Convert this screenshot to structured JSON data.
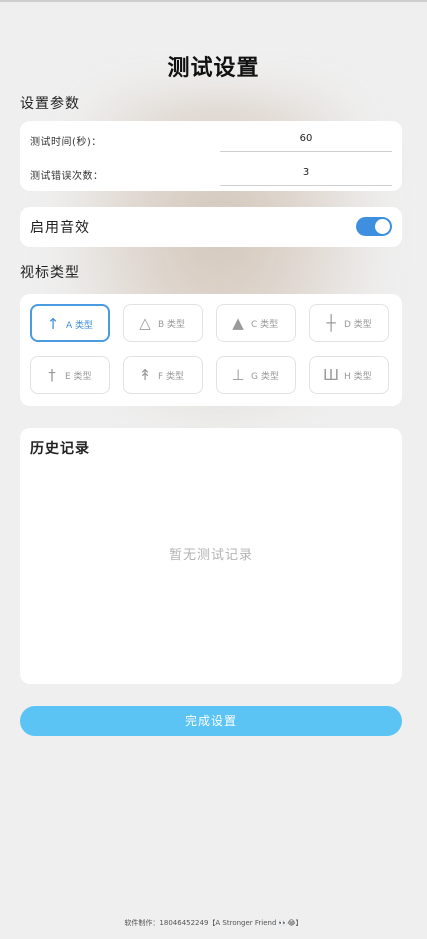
{
  "page": {
    "title": "测试设置"
  },
  "params": {
    "section_label": "设置参数",
    "time_label": "测试时间(秒)：",
    "time_value": "60",
    "errors_label": "测试错误次数：",
    "errors_value": "3"
  },
  "sound": {
    "label": "启用音效",
    "enabled": true
  },
  "optotype": {
    "section_label": "视标类型",
    "types": [
      {
        "label": "A 类型",
        "icon": "up-arrow-icon",
        "glyph": "↑",
        "selected": true
      },
      {
        "label": "B 类型",
        "icon": "triangle-outline-icon",
        "glyph": "△",
        "selected": false
      },
      {
        "label": "C 类型",
        "icon": "triangle-filled-icon",
        "glyph": "▲",
        "selected": false
      },
      {
        "label": "D 类型",
        "icon": "cross-icon",
        "glyph": "┼",
        "selected": false
      },
      {
        "label": "E 类型",
        "icon": "dagger-icon",
        "glyph": "†",
        "selected": false
      },
      {
        "label": "F 类型",
        "icon": "arrow-bar-icon",
        "glyph": "↟",
        "selected": false
      },
      {
        "label": "G 类型",
        "icon": "up-tack-icon",
        "glyph": "⊥",
        "selected": false
      },
      {
        "label": "H 类型",
        "icon": "three-bar-icon",
        "glyph": "Ш",
        "selected": false
      }
    ]
  },
  "history": {
    "title": "历史记录",
    "empty_text": "暂无测试记录"
  },
  "done_button": {
    "label": "完成设置"
  },
  "footer": {
    "text": "软件制作：18046452249【A Stronger Friend 👀😂】"
  },
  "colors": {
    "accent": "#3f8fe0",
    "button": "#5bc4f4",
    "background": "#efefef"
  }
}
